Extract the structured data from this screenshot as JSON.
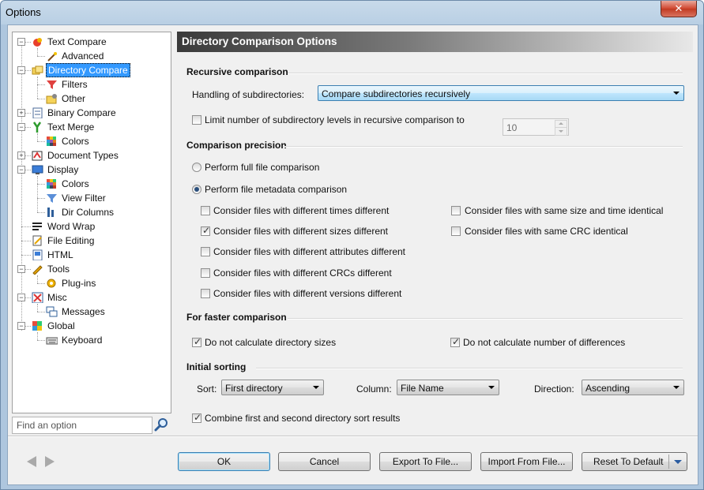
{
  "window": {
    "title": "Options",
    "close_glyph": "✕"
  },
  "tree": {
    "items": [
      {
        "label": "Text Compare",
        "icon": "text-compare-icon"
      },
      {
        "label": "Advanced",
        "icon": "wand-icon"
      },
      {
        "label": "Directory Compare",
        "icon": "folders-icon"
      },
      {
        "label": "Filters",
        "icon": "filter-icon"
      },
      {
        "label": "Other",
        "icon": "folder-gear-icon"
      },
      {
        "label": "Binary Compare",
        "icon": "binary-icon"
      },
      {
        "label": "Text Merge",
        "icon": "merge-icon"
      },
      {
        "label": "Colors",
        "icon": "colors-grid-icon"
      },
      {
        "label": "Document Types",
        "icon": "document-types-icon"
      },
      {
        "label": "Display",
        "icon": "monitor-icon"
      },
      {
        "label": "Colors",
        "icon": "colors-grid-icon"
      },
      {
        "label": "View Filter",
        "icon": "view-filter-icon"
      },
      {
        "label": "Dir Columns",
        "icon": "dir-columns-icon"
      },
      {
        "label": "Word Wrap",
        "icon": "word-wrap-icon"
      },
      {
        "label": "File Editing",
        "icon": "file-edit-icon"
      },
      {
        "label": "HTML",
        "icon": "html-icon"
      },
      {
        "label": "Tools",
        "icon": "wrench-icon"
      },
      {
        "label": "Plug-ins",
        "icon": "plugin-gear-icon"
      },
      {
        "label": "Misc",
        "icon": "misc-icon"
      },
      {
        "label": "Messages",
        "icon": "messages-icon"
      },
      {
        "label": "Global",
        "icon": "global-icon"
      },
      {
        "label": "Keyboard",
        "icon": "keyboard-icon"
      }
    ],
    "selected": "Directory Compare"
  },
  "search": {
    "placeholder": "Find an option",
    "icon": "search-icon"
  },
  "panel": {
    "title": "Directory Comparison Options",
    "recursive": {
      "heading": "Recursive comparison",
      "handling_label": "Handling of subdirectories:",
      "handling_value": "Compare subdirectories recursively",
      "limit_label": "Limit number of subdirectory levels in recursive comparison to",
      "limit_checked": false,
      "limit_value": "10"
    },
    "precision": {
      "heading": "Comparison precision",
      "full_label": "Perform full file comparison",
      "metadata_label": "Perform file metadata comparison",
      "selected": "metadata",
      "options": [
        {
          "label": "Consider files with different times different",
          "checked": false
        },
        {
          "label": "Consider files with different sizes different",
          "checked": true
        },
        {
          "label": "Consider files with different attributes different",
          "checked": false
        },
        {
          "label": "Consider files with different CRCs different",
          "checked": false
        },
        {
          "label": "Consider files with different versions different",
          "checked": false
        },
        {
          "label": "Consider files with same size and time identical",
          "checked": false
        },
        {
          "label": "Consider files with same CRC identical",
          "checked": false
        }
      ]
    },
    "faster": {
      "heading": "For faster comparison",
      "dir_sizes_label": "Do not calculate directory sizes",
      "dir_sizes_checked": true,
      "num_diffs_label": "Do not calculate number of differences",
      "num_diffs_checked": true
    },
    "sorting": {
      "heading": "Initial sorting",
      "sort_label": "Sort:",
      "sort_value": "First directory",
      "column_label": "Column:",
      "column_value": "File Name",
      "direction_label": "Direction:",
      "direction_value": "Ascending",
      "combine_label": "Combine first and second directory sort results",
      "combine_checked": true
    }
  },
  "buttons": {
    "ok": "OK",
    "cancel": "Cancel",
    "export": "Export To File...",
    "import": "Import From File...",
    "reset": "Reset To Default"
  },
  "colors": {
    "header_dark": "#3a3a3a",
    "selection": "#3399ff",
    "accent": "#3c7fb1"
  }
}
